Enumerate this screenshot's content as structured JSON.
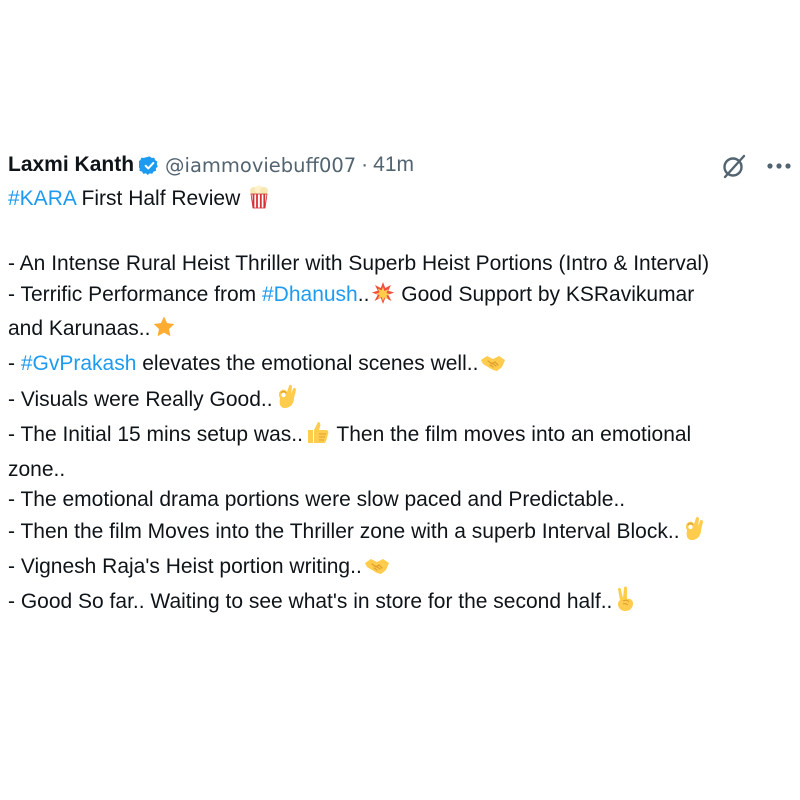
{
  "author": {
    "name": "Laxmi Kanth",
    "handle": "@iammoviebuff007",
    "separator": "·",
    "time": "41m"
  },
  "actions": {
    "grok_icon": "grok-slash-circle-icon",
    "more_label": "···"
  },
  "tweet": {
    "l1": {
      "tag": "#KARA",
      "text": " First Half Review "
    },
    "l2": "",
    "l3": "- An Intense Rural Heist Thriller with Superb Heist Portions (Intro & Interval)",
    "l4": {
      "pre": "- Terrific Performance from ",
      "tag": "#Dhanush",
      "post1": "..",
      "post2": " Good Support by KSRavikumar"
    },
    "l5": "and Karunaas..",
    "l6": {
      "pre": "- ",
      "tag": "#GvPrakash",
      "post": " elevates the emotional scenes well.."
    },
    "l7": "- Visuals were Really Good..",
    "l8": {
      "pre": "- The Initial 15 mins setup was..",
      "post": " Then the film moves into an emotional"
    },
    "l9": "zone..",
    "l10": "- The emotional drama portions were slow paced and Predictable..",
    "l11": "- Then the film Moves into the Thriller zone with a superb Interval Block..",
    "l12": "- Vignesh Raja's Heist portion writing..",
    "l13": "- Good So far.. Waiting to see what's in store for the second half.."
  },
  "colors": {
    "accent": "#1d9bf0",
    "text": "#0f1419",
    "muted": "#536471"
  },
  "emojis": [
    "popcorn",
    "collision",
    "star",
    "handshake",
    "ok-hand",
    "thumbs-up",
    "ok-hand",
    "handshake",
    "victory-hand"
  ]
}
